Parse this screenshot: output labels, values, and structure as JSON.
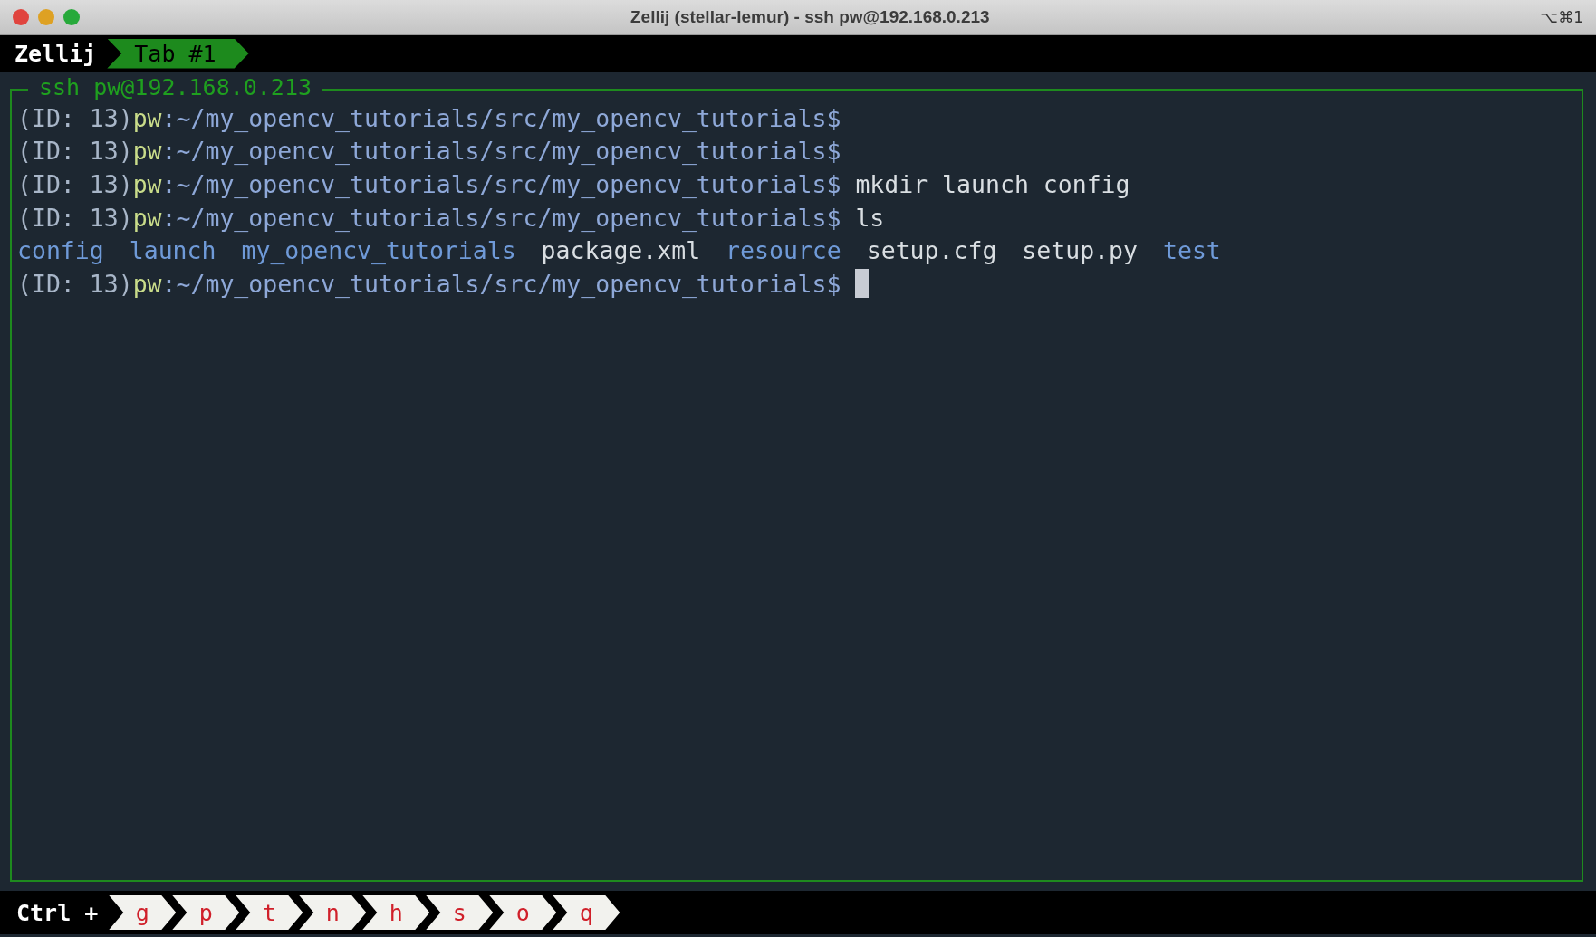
{
  "window": {
    "title": "Zellij (stellar-lemur) - ssh pw@192.168.0.213",
    "shortcut": "⌥⌘1"
  },
  "tab_bar": {
    "session": "Zellij",
    "tabs": [
      {
        "label": "Tab #1",
        "selected": true
      }
    ]
  },
  "pane": {
    "title": "ssh pw@192.168.0.213",
    "lines": [
      {
        "kind": "prompt",
        "id": "(ID: 13)",
        "user": "pw",
        "path": ":~/my_opencv_tutorials/src/my_opencv_tutorials$",
        "cursor": false
      },
      {
        "kind": "prompt",
        "id": "(ID: 13)",
        "user": "pw",
        "path": ":~/my_opencv_tutorials/src/my_opencv_tutorials$",
        "cursor": false
      },
      {
        "kind": "prompt",
        "id": "(ID: 13)",
        "user": "pw",
        "path": ":~/my_opencv_tutorials/src/my_opencv_tutorials$",
        "command": "mkdir launch config",
        "cursor": false
      },
      {
        "kind": "prompt",
        "id": "(ID: 13)",
        "user": "pw",
        "path": ":~/my_opencv_tutorials/src/my_opencv_tutorials$",
        "command": "ls",
        "cursor": false
      },
      {
        "kind": "listing",
        "entries": [
          {
            "name": "config",
            "kind": "dir"
          },
          {
            "name": "launch",
            "kind": "dir"
          },
          {
            "name": "my_opencv_tutorials",
            "kind": "dir"
          },
          {
            "name": "package.xml",
            "kind": "file"
          },
          {
            "name": "resource",
            "kind": "dir"
          },
          {
            "name": "setup.cfg",
            "kind": "file"
          },
          {
            "name": "setup.py",
            "kind": "file"
          },
          {
            "name": "test",
            "kind": "dir"
          }
        ]
      },
      {
        "kind": "prompt",
        "id": "(ID: 13)",
        "user": "pw",
        "path": ":~/my_opencv_tutorials/src/my_opencv_tutorials$",
        "cursor": true
      }
    ]
  },
  "status_bar": {
    "modifier": "Ctrl +",
    "keys": [
      "g",
      "p",
      "t",
      "n",
      "h",
      "s",
      "o",
      "q"
    ]
  }
}
